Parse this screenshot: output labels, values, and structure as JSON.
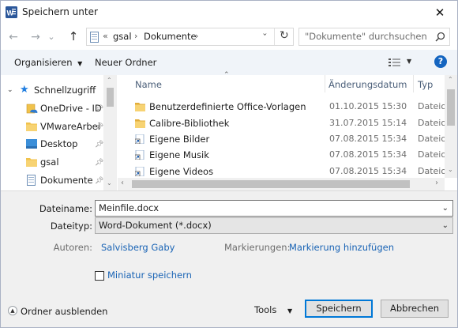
{
  "window": {
    "title": "Speichern unter",
    "close_glyph": "✕"
  },
  "nav": {
    "back": "←",
    "forward": "→",
    "recent": "⌄",
    "up": "↑",
    "path_prefix": "«",
    "breadcrumb": [
      "gsal",
      "Dokumente"
    ],
    "separator": "›",
    "refresh": "↻",
    "search_placeholder": "\"Dokumente\" durchsuchen"
  },
  "toolbar": {
    "organize_label": "Organisieren",
    "new_folder_label": "Neuer Ordner",
    "help": "?"
  },
  "sidebar": {
    "items": [
      {
        "label": "Schnellzugriff",
        "icon": "star-icon",
        "pinned": false
      },
      {
        "label": "OneDrive - ID",
        "icon": "onedrive-icon",
        "pinned": true
      },
      {
        "label": "VMwareArbei",
        "icon": "folder-icon",
        "pinned": true
      },
      {
        "label": "Desktop",
        "icon": "desktop-icon",
        "pinned": true
      },
      {
        "label": "gsal",
        "icon": "folder-icon",
        "pinned": true
      },
      {
        "label": "Dokumente",
        "icon": "documents-icon",
        "pinned": true
      }
    ]
  },
  "files": {
    "columns": {
      "name": "Name",
      "date": "Änderungsdatum",
      "type": "Typ"
    },
    "rows": [
      {
        "name": "Benutzerdefinierte Office-Vorlagen",
        "date": "01.10.2015 15:30",
        "type": "Dateio",
        "icon": "folder-icon"
      },
      {
        "name": "Calibre-Bibliothek",
        "date": "31.07.2015 15:14",
        "type": "Dateio",
        "icon": "folder-icon"
      },
      {
        "name": "Eigene Bilder",
        "date": "07.08.2015 15:34",
        "type": "Dateio",
        "icon": "shortcut-folder-icon"
      },
      {
        "name": "Eigene Musik",
        "date": "07.08.2015 15:34",
        "type": "Dateio",
        "icon": "shortcut-folder-icon"
      },
      {
        "name": "Eigene Videos",
        "date": "07.08.2015 15:34",
        "type": "Dateio",
        "icon": "shortcut-folder-icon"
      }
    ]
  },
  "form": {
    "filename_label": "Dateiname:",
    "filename_value": "Meinfile.docx",
    "filetype_label": "Dateityp:",
    "filetype_value": "Word-Dokument (*.docx)",
    "authors_label": "Autoren:",
    "authors_value": "Salvisberg Gaby",
    "tags_label": "Markierungen:",
    "tags_value": "Markierung hinzufügen",
    "thumbnail_label": "Miniatur speichern",
    "thumbnail_checked": false
  },
  "footer": {
    "hide_folders_label": "Ordner ausblenden",
    "tools_label": "Tools",
    "save_label": "Speichern",
    "cancel_label": "Abbrechen"
  },
  "colors": {
    "accent": "#0078d7",
    "link": "#1a64b5",
    "folder": "#f0c24b",
    "word": "#2b579a"
  }
}
